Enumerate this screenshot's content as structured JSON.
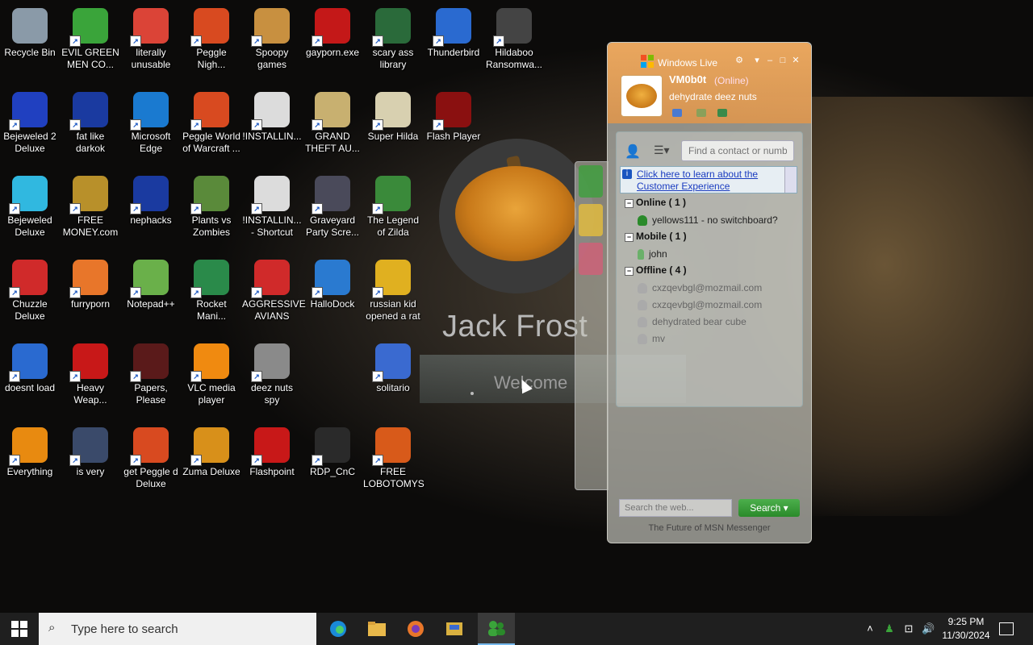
{
  "desktop": {
    "icons": [
      {
        "label": "Recycle Bin",
        "icon": "recycle-bin-icon",
        "color": "#8a9aa8"
      },
      {
        "label": "EVIL GREEN MEN CO...",
        "icon": "messenger-people-icon",
        "color": "#3aa43a"
      },
      {
        "label": "literally unusable",
        "icon": "chrome-icon",
        "color": "#db4437"
      },
      {
        "label": "Peggle Nigh...",
        "icon": "peggle-icon",
        "color": "#d84a20"
      },
      {
        "label": "Spoopy games",
        "icon": "folder-icon",
        "color": "#c89040"
      },
      {
        "label": "gayporn.exe",
        "icon": "flash-icon",
        "color": "#c41818"
      },
      {
        "label": "scary ass library",
        "icon": "game-shield-icon",
        "color": "#2a6a3a"
      },
      {
        "label": "Thunderbird",
        "icon": "thunderbird-icon",
        "color": "#2a6ad0"
      },
      {
        "label": "Hildaboo Ransomwa...",
        "icon": "shield-app-icon",
        "color": "#444"
      },
      {
        "label": "Bejeweled 2 Deluxe",
        "icon": "bejeweled-icon",
        "color": "#2040c0"
      },
      {
        "label": "fat like darkok",
        "icon": "mpi-icon",
        "color": "#1a3aa0"
      },
      {
        "label": "Microsoft Edge",
        "icon": "edge-icon",
        "color": "#1a7ad0"
      },
      {
        "label": "Peggle World of Warcraft ...",
        "icon": "peggle-icon",
        "color": "#d84a20"
      },
      {
        "label": "!INSTALLIN...",
        "icon": "document-icon",
        "color": "#dcdcdc"
      },
      {
        "label": "GRAND THEFT AU...",
        "icon": "hat-girl-icon",
        "color": "#c8b070"
      },
      {
        "label": "Super Hilda",
        "icon": "pixel-dog-icon",
        "color": "#d8d0b0"
      },
      {
        "label": "Flash Player",
        "icon": "flash-icon",
        "color": "#8a1010"
      },
      {
        "label": "Bejeweled Deluxe",
        "icon": "diamond-icon",
        "color": "#30b8e0"
      },
      {
        "label": "FREE MONEY.com",
        "icon": "money-bag-icon",
        "color": "#b8902a"
      },
      {
        "label": "nephacks",
        "icon": "mpi-icon",
        "color": "#1a3aa0"
      },
      {
        "label": "Plants vs Zombies",
        "icon": "plant-icon",
        "color": "#5a8a3a"
      },
      {
        "label": "!INSTALLIN... - Shortcut",
        "icon": "document-icon",
        "color": "#dcdcdc"
      },
      {
        "label": "Graveyard Party Scre...",
        "icon": "graveyard-icon",
        "color": "#4a4a5a"
      },
      {
        "label": "The Legend of Zilda",
        "icon": "legend-icon",
        "color": "#3a8a3a"
      },
      {
        "label": "Chuzzle Deluxe",
        "icon": "chuzzle-icon",
        "color": "#d02a2a"
      },
      {
        "label": "furryporn",
        "icon": "firefox-icon",
        "color": "#e8762a"
      },
      {
        "label": "Notepad++",
        "icon": "notepad-icon",
        "color": "#6ab04a"
      },
      {
        "label": "Rocket Mani...",
        "icon": "rocket-icon",
        "color": "#2a8a4a"
      },
      {
        "label": "AGGRESSIVE AVIANS",
        "icon": "angry-bird-icon",
        "color": "#d02a2a"
      },
      {
        "label": "HalloDock",
        "icon": "windows-shield-icon",
        "color": "#2a7ad0"
      },
      {
        "label": "russian kid opened a rat",
        "icon": "de-icon",
        "color": "#e0b020"
      },
      {
        "label": "doesnt load",
        "icon": "thunderbird-icon",
        "color": "#2a6ad0"
      },
      {
        "label": "Heavy Weap...",
        "icon": "radiation-icon",
        "color": "#c81818"
      },
      {
        "label": "Papers, Please",
        "icon": "papers-icon",
        "color": "#5a1a1a"
      },
      {
        "label": "VLC media player",
        "icon": "vlc-icon",
        "color": "#f08a10"
      },
      {
        "label": "deez nuts spy",
        "icon": "windows-stack-icon",
        "color": "#8a8a8a"
      },
      {
        "label": "solitario",
        "icon": "solitaire-icon",
        "color": "#3a6ad0"
      },
      {
        "label": "Everything",
        "icon": "magnifier-icon",
        "color": "#e88a10"
      },
      {
        "label": "is very",
        "icon": "mpi-shield-icon",
        "color": "#3a4a6a"
      },
      {
        "label": "get Peggle d Deluxe",
        "icon": "peggle-icon",
        "color": "#d84a20"
      },
      {
        "label": "Zuma Deluxe",
        "icon": "zuma-icon",
        "color": "#d8901a"
      },
      {
        "label": "Flashpoint",
        "icon": "flashpoint-icon",
        "color": "#c81818"
      },
      {
        "label": "RDP_CnC",
        "icon": "rdp-icon",
        "color": "#2a2a2a"
      },
      {
        "label": "FREE LOBOTOMYS",
        "icon": "clock-icon",
        "color": "#d85a1a"
      }
    ]
  },
  "lockscreen": {
    "name": "Jack Frost",
    "welcome": "Welcome"
  },
  "messenger": {
    "title": "Windows Live",
    "user": "VM0b0t",
    "status": "(Online)",
    "psm": "dehydrate deez nuts",
    "find_placeholder": "Find a contact or numbe",
    "info_text": "Click here to learn about the Customer Experience",
    "groups": {
      "online": "Online ( 1 )",
      "mobile": "Mobile ( 1 )",
      "offline": "Offline ( 4 )"
    },
    "contacts": {
      "online": [
        "yellows111 - no switchboard?"
      ],
      "mobile": [
        "john"
      ],
      "offline": [
        "cxzqevbgl@mozmail.com",
        "cxzqevbgl@mozmail.com",
        "dehydrated bear cube",
        "mv"
      ]
    },
    "web_search_placeholder": "Search the web...",
    "search_button": "Search",
    "footer": "The Future of MSN Messenger"
  },
  "taskbar": {
    "search_placeholder": "Type here to search",
    "apps": [
      {
        "name": "edge",
        "icon": "edge-icon"
      },
      {
        "name": "file-explorer",
        "icon": "folder-icon"
      },
      {
        "name": "firefox",
        "icon": "firefox-icon"
      },
      {
        "name": "file-manager-disk",
        "icon": "disk-icon"
      },
      {
        "name": "messenger",
        "icon": "messenger-people-icon",
        "active": true
      }
    ],
    "time": "9:25 PM",
    "date": "11/30/2024"
  }
}
